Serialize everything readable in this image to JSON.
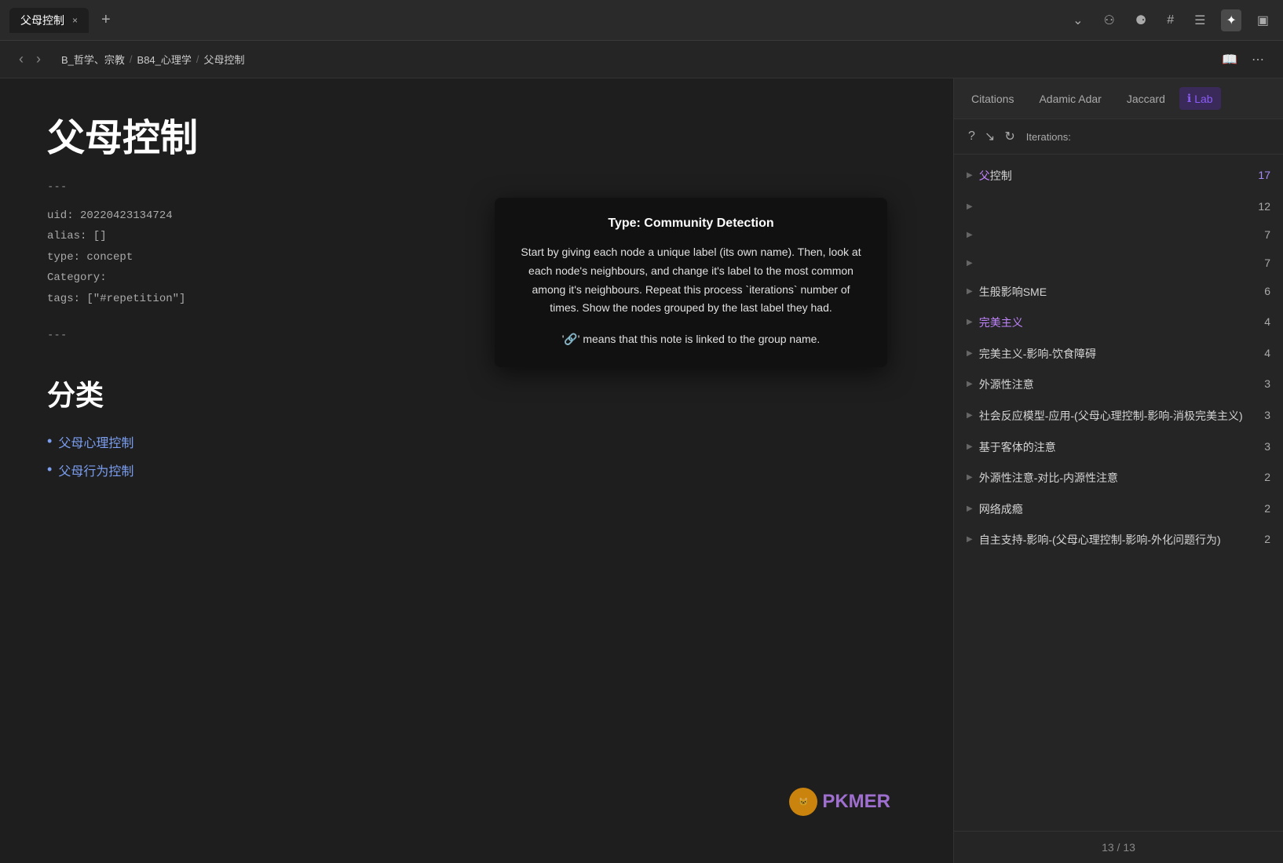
{
  "titlebar": {
    "tab_label": "父母控制",
    "close_icon": "×",
    "add_tab_icon": "+",
    "icons": [
      {
        "name": "dropdown-icon",
        "symbol": "⌄"
      },
      {
        "name": "link-icon",
        "symbol": "🔗"
      },
      {
        "name": "link2-icon",
        "symbol": "🔗"
      },
      {
        "name": "hash-icon",
        "symbol": "#"
      },
      {
        "name": "list-icon",
        "symbol": "☰"
      },
      {
        "name": "graph-icon",
        "symbol": "⬡"
      },
      {
        "name": "layout-icon",
        "symbol": "▣"
      }
    ]
  },
  "toolbar": {
    "back_icon": "‹",
    "forward_icon": "›",
    "breadcrumb": [
      "B_哲学、宗教",
      "B84_心理学",
      "父母控制"
    ],
    "breadcrumb_sep": "/",
    "book_icon": "📖",
    "more_icon": "⋯"
  },
  "note": {
    "title": "父母控制",
    "divider": "---",
    "meta_lines": [
      "uid: 20220423134724",
      "alias: []",
      "type: concept",
      "Category:",
      "tags: [\"#repetition\"]"
    ],
    "divider2": "---",
    "section_title": "分类",
    "links": [
      {
        "text": "父母心理控制"
      },
      {
        "text": "父母行为控制"
      }
    ]
  },
  "right_panel": {
    "tabs": [
      {
        "label": "Citations",
        "active": false
      },
      {
        "label": "Adamic Adar",
        "active": false
      },
      {
        "label": "Jaccard",
        "active": false
      },
      {
        "label": "Lab",
        "active": true,
        "icon": "ℹ"
      }
    ],
    "subheader": {
      "help_icon": "?",
      "trend_icon": "↘",
      "refresh_icon": "↻",
      "iterations_label": "Iterations:"
    },
    "communities": [
      {
        "name": "父控制",
        "count": 17,
        "highlight": true,
        "arrow": "▶"
      },
      {
        "name": "",
        "count": 12,
        "arrow": "▶"
      },
      {
        "name": "",
        "count": 7,
        "arrow": "▶"
      },
      {
        "name": "",
        "count": 7,
        "arrow": "▶"
      },
      {
        "name": "生般影响SME",
        "count": 6,
        "arrow": "▶"
      },
      {
        "name": "",
        "count": 4,
        "arrow": "▶"
      },
      {
        "name": "完美主义-影响-饮食障碍",
        "count": 4,
        "arrow": "▶"
      },
      {
        "name": "外源性注意",
        "count": 3,
        "arrow": "▶"
      },
      {
        "name": "社会反应模型-应用-(父母心理控制-影响-消极完美主义)",
        "count": 3,
        "arrow": "▶"
      },
      {
        "name": "基于客体的注意",
        "count": 3,
        "arrow": "▶"
      },
      {
        "name": "外源性注意-对比-内源性注意",
        "count": 2,
        "arrow": "▶"
      },
      {
        "name": "网络成瘾",
        "count": 2,
        "arrow": "▶"
      },
      {
        "name": "自主支持-影响-(父母心理控制-影响-外化问题行为)",
        "count": 2,
        "arrow": "▶"
      }
    ],
    "footer": "13 / 13"
  },
  "tooltip": {
    "title": "Type: Community Detection",
    "body": "Start by giving each node a unique label (its own name). Then, look at each node's neighbours, and change it's label to the most common among it's neighbours. Repeat this process `iterations` number of times. Show the nodes grouped by the last label they had.",
    "note": "'🔗' means that this note is linked to the group name."
  },
  "pkmer": {
    "text": "PKMER"
  }
}
